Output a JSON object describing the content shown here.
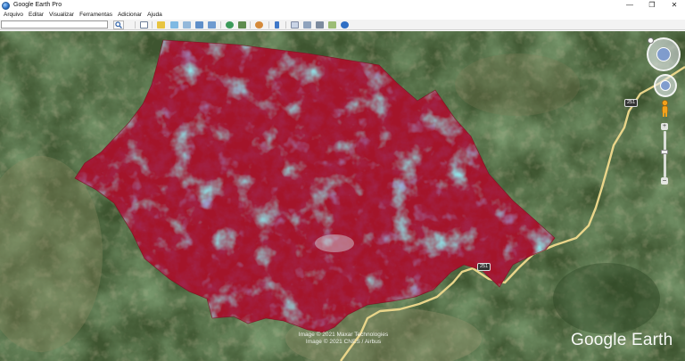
{
  "window": {
    "title": "Google Earth Pro",
    "minimize_glyph": "—",
    "maximize_glyph": "❐",
    "close_glyph": "✕"
  },
  "menu": [
    {
      "label": "Arquivo"
    },
    {
      "label": "Editar"
    },
    {
      "label": "Visualizar"
    },
    {
      "label": "Ferramentas"
    },
    {
      "label": "Adicionar"
    },
    {
      "label": "Ajuda"
    }
  ],
  "search": {
    "value": "",
    "placeholder": "",
    "icon": "search-icon"
  },
  "toolbar_icons": [
    "sidebar-toggle-icon",
    "placemark-icon",
    "polygon-icon",
    "path-icon",
    "image-overlay-icon",
    "record-tour-icon",
    "historical-imagery-icon",
    "sunlight-icon",
    "planets-icon",
    "ruler-icon",
    "email-icon",
    "print-icon",
    "save-image-icon",
    "view-in-maps-icon",
    "earth-gallery-icon"
  ],
  "map": {
    "road_shields": [
      "251",
      "251"
    ],
    "attribution_lines": [
      "Image © 2021 Maxar Technologies",
      "Image © 2021 CNES / Airbus"
    ],
    "logo": "Google Earth"
  },
  "nav": {
    "zoom_plus": "+",
    "zoom_minus": "−"
  },
  "colors": {
    "overlay_red": "#a4142a",
    "overlay_cyan": "#3bb8bd",
    "road": "#e9d58a",
    "terrain": "#3f5530"
  }
}
